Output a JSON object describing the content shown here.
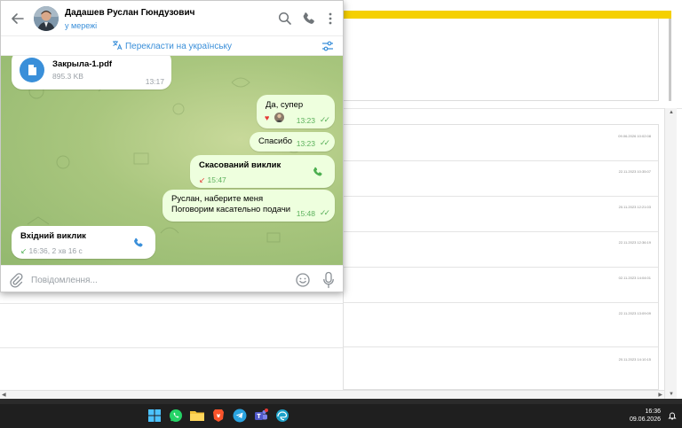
{
  "chat": {
    "contact_name": "Дадашев Руслан Гюндузович",
    "status": "у мережі",
    "translate_label": "Перекласти на українську"
  },
  "messages": {
    "file": {
      "name": "Закрыла-1.pdf",
      "size": "895.3 KB",
      "time": "13:17"
    },
    "msg1": {
      "text": "Да, супер",
      "time": "13:23",
      "reactions": [
        "heart",
        "avatar"
      ]
    },
    "msg2": {
      "text": "Спасибо",
      "time": "13:23"
    },
    "call_cancelled": {
      "title": "Скасований виклик",
      "time": "15:47"
    },
    "msg3": {
      "line1": "Руслан, наберите меня",
      "line2": "Поговорим касательно подачи",
      "time": "15:48"
    },
    "call_incoming": {
      "title": "Вхідний виклик",
      "detail": "16:36, 2 хв 16 с"
    }
  },
  "composer": {
    "placeholder": "Повідомлення..."
  },
  "background_list": {
    "dates": [
      "09.06.2026 10:02:08",
      "22.11.2023 10:35:07",
      "20.11.2023 12:21:03",
      "22.11.2023 12:36:19",
      "02.11.2023 14:04:01",
      "22.11.2023 13:09:09",
      "20.11.2023 14:10:15"
    ]
  },
  "taskbar": {
    "time": "16:36",
    "date": "09.06.2026",
    "apps": [
      "windows-start",
      "whatsapp",
      "file-explorer",
      "brave-browser",
      "telegram",
      "teams",
      "edge"
    ]
  },
  "colors": {
    "accent": "#3a8fd9",
    "outgoing_bubble": "#eeffde",
    "read_ticks": "#5bb05b",
    "missed_call": "#e53935",
    "incoming_call": "#4caf50",
    "bg_yellow": "#f5d000",
    "taskbar": "#1f1f1f"
  }
}
